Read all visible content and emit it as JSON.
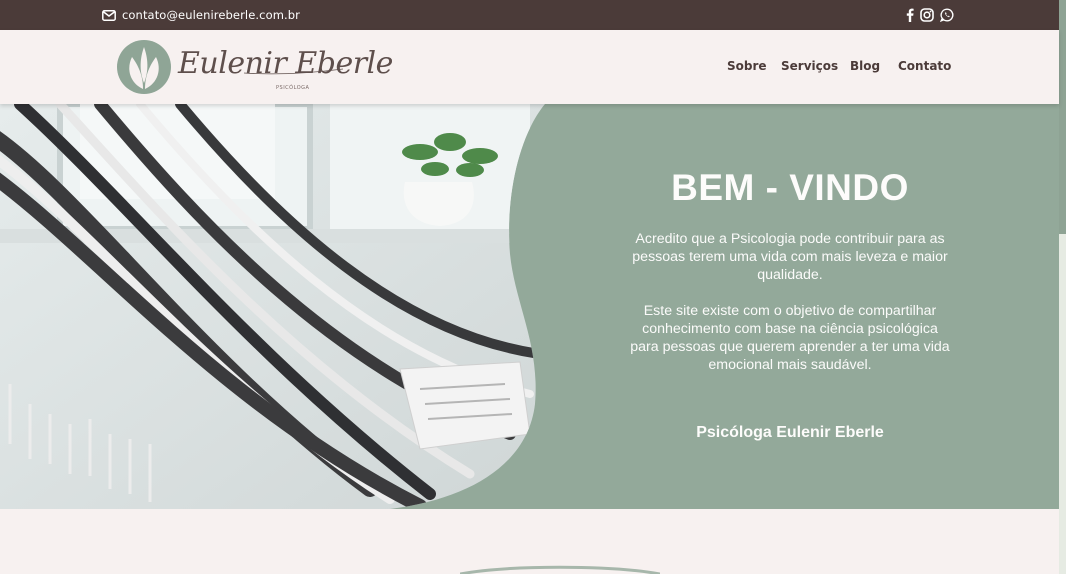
{
  "topbar": {
    "email": "contato@eulenireberle.com.br",
    "icons": [
      "envelope-icon",
      "facebook-icon",
      "instagram-icon",
      "whatsapp-icon"
    ]
  },
  "logo": {
    "name": "Eulenir Eberle",
    "subtitle": "PSICÓLOGA"
  },
  "nav": {
    "items": [
      "Sobre",
      "Serviços",
      "Blog",
      "Contato"
    ]
  },
  "hero": {
    "title": "BEM - VINDO",
    "paragraph1": "Acredito que a Psicologia pode contribuir para as pessoas terem uma vida com mais leveza e maior qualidade.",
    "paragraph2": "Este site existe com o objetivo de compartilhar conhecimento com base na ciência psicológica para pessoas que querem aprender a ter uma vida emocional mais saudável.",
    "signature": "Psicóloga Eulenir Eberle"
  },
  "colors": {
    "topbar": "#4b3b39",
    "header": "#f7f1f0",
    "accent_green": "#93a99a",
    "text_dark": "#4b3b39"
  }
}
